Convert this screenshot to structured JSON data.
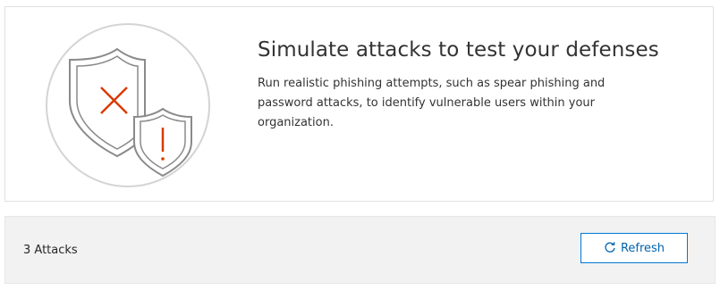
{
  "hero": {
    "title": "Simulate attacks to test your defenses",
    "description": "Run realistic phishing attempts, such as spear phishing and password attacks, to identify vulnerable users within your organization."
  },
  "status": {
    "count_label": "3 Attacks",
    "refresh_label": "Refresh"
  },
  "icons": {
    "illustration": "shield-warning-illustration",
    "refresh": "refresh-icon"
  },
  "colors": {
    "accent": "#0078d4",
    "alert": "#d83b01",
    "outline": "#8a8a8a"
  }
}
